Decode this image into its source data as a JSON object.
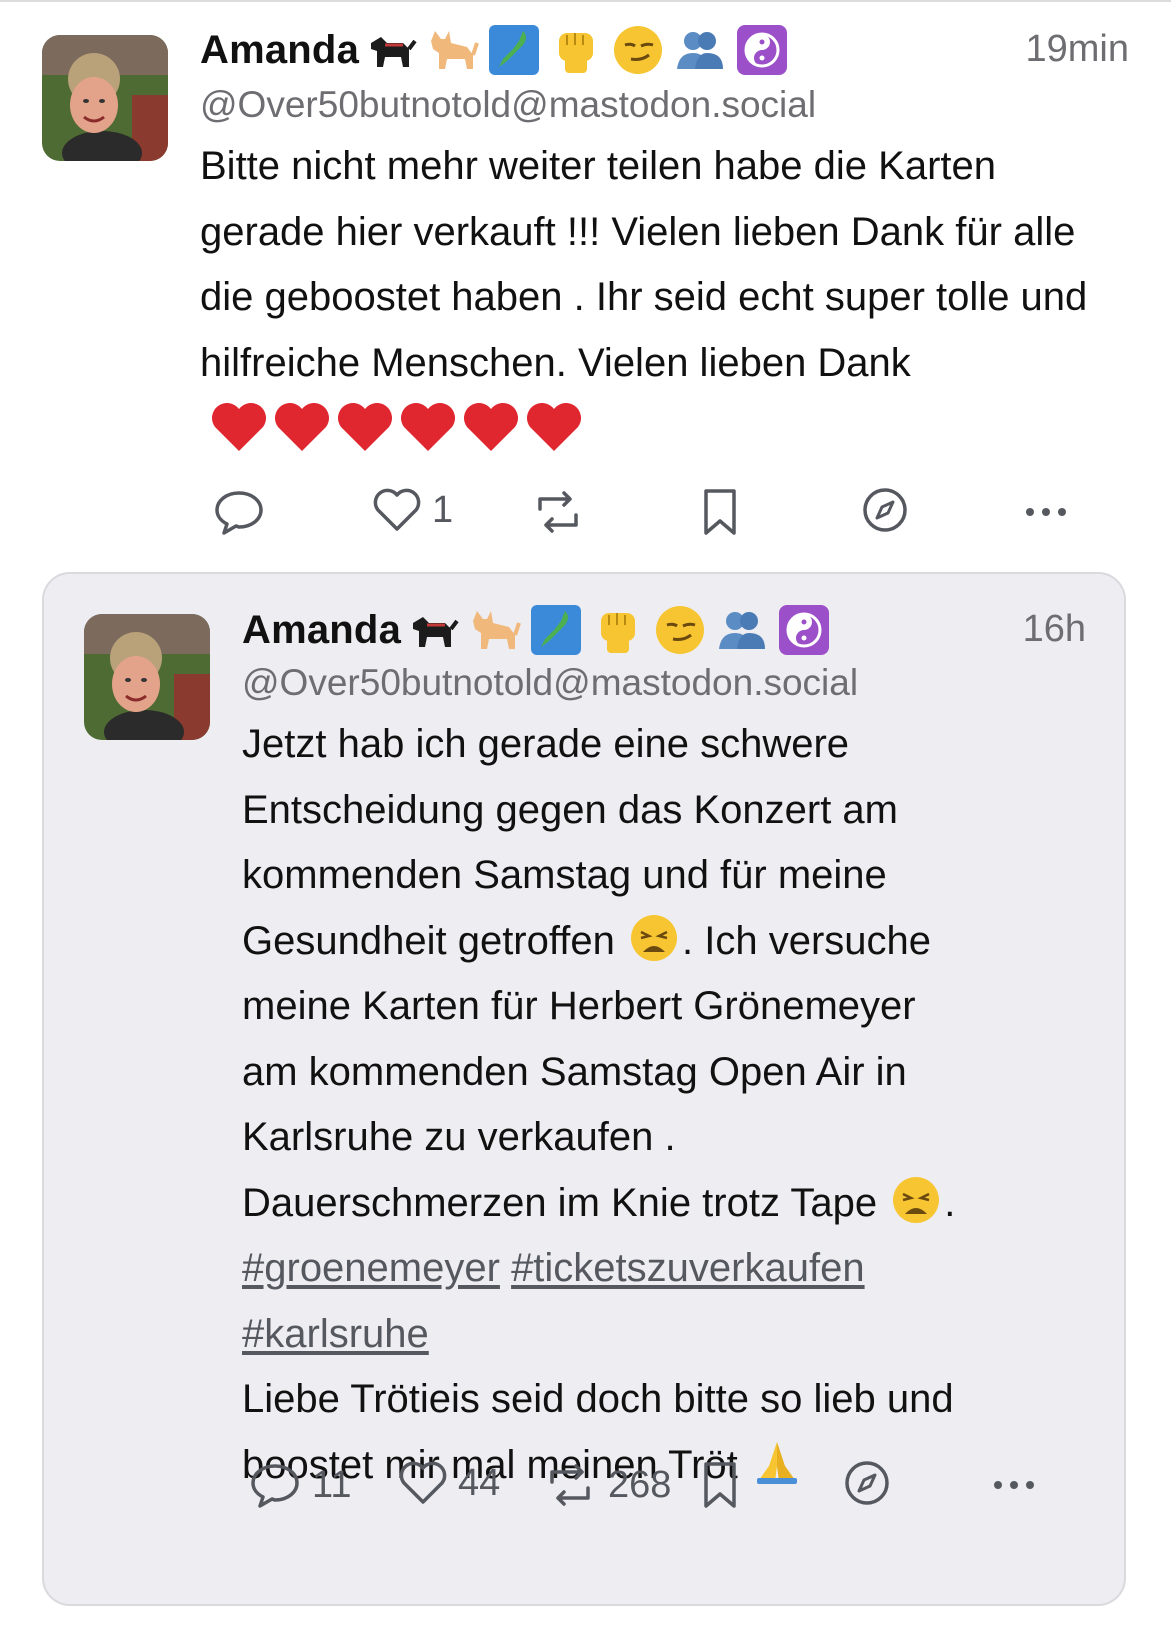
{
  "post": {
    "author_name": "Amanda",
    "handle": "@Over50butnotold@mastodon.social",
    "time": "19min",
    "body_text": "Bitte nicht mehr weiter teilen habe die Karten gerade hier verkauft !!!  Vielen lieben Dank für alle die geboostet haben . Ihr seid echt super tolle und hilfreiche Menschen. Vielen lieben Dank",
    "name_emojis": [
      "dog-emoji",
      "cat-emoji",
      "japan-map-emoji",
      "raised-fist-emoji",
      "smirk-emoji",
      "two-people-emoji",
      "yin-yang-emoji"
    ],
    "trailing_hearts": 6,
    "actions": {
      "reply_count": "",
      "favourite_count": "1",
      "boost_count": ""
    }
  },
  "quoted": {
    "author_name": "Amanda",
    "handle": "@Over50butnotold@mastodon.social",
    "time": "16h",
    "body_line_1": "Jetzt hab ich gerade eine schwere",
    "body_line_2": "Entscheidung gegen das Konzert am",
    "body_line_3": "kommenden Samstag und für meine",
    "body_line_4a": "Gesundheit getroffen",
    "body_line_4b": ".  Ich versuche",
    "body_line_5": "meine Karten für Herbert Grönemeyer",
    "body_line_6": "am kommenden Samstag Open Air in",
    "body_line_7": "Karlsruhe zu verkaufen .",
    "body_line_8a": "Dauerschmerzen im Knie trotz Tape",
    "body_line_8b": ".",
    "hashtags": [
      "#groenemeyer",
      "#ticketszuverkaufen",
      "#karlsruhe"
    ],
    "body_line_9": "Liebe Trötieis seid doch bitte so lieb und",
    "body_line_10": "boostet  mir mal meinen Tröt",
    "actions": {
      "reply_count": "11",
      "favourite_count": "44",
      "boost_count": "268"
    }
  },
  "colors": {
    "muted": "#6d6d72",
    "card_bg": "#eeeef2",
    "heart": "#e0262f"
  }
}
